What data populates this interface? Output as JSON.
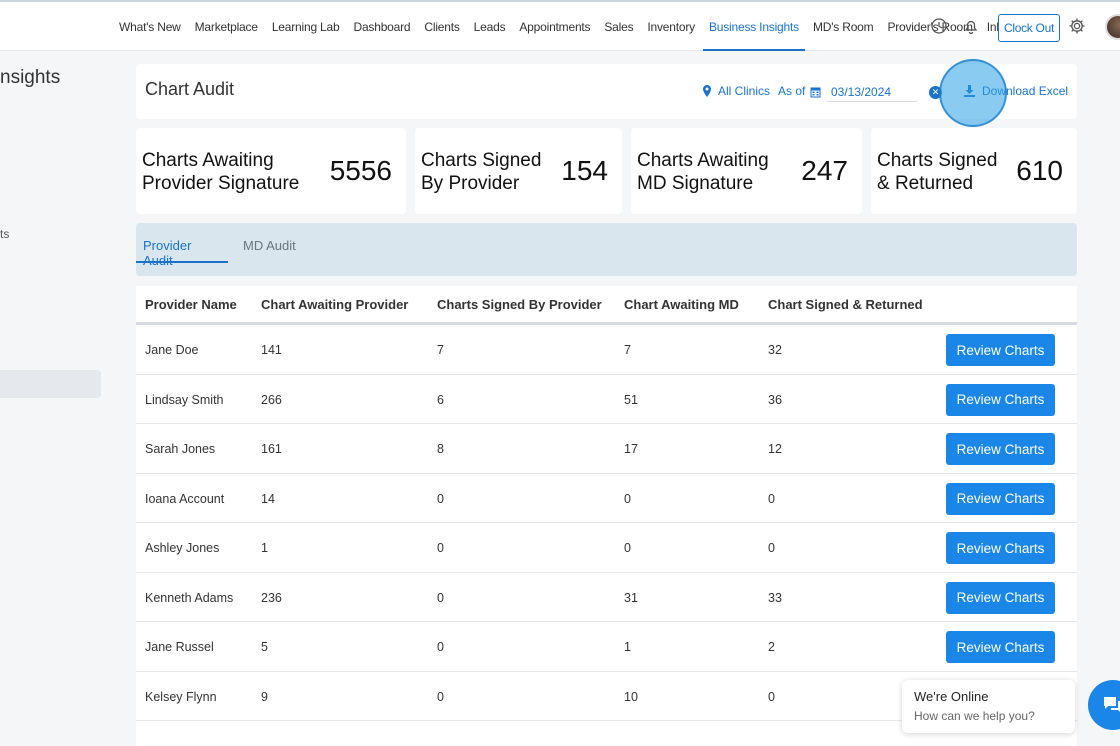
{
  "nav": {
    "items": [
      "What's New",
      "Marketplace",
      "Learning Lab",
      "Dashboard",
      "Clients",
      "Leads",
      "Appointments",
      "Sales",
      "Inventory",
      "Business Insights",
      "MD's Room",
      "Provider's Room",
      "Inbox"
    ],
    "active": "Business Insights",
    "clock_out_label": "Clock Out"
  },
  "sidebar": {
    "title": "nsights",
    "fragment": "ts"
  },
  "header": {
    "title": "Chart Audit",
    "clinic_filter": "All Clinics",
    "as_of_label": "As of",
    "date_value": "03/13/2024",
    "download_label": "Download Excel"
  },
  "stats": [
    {
      "label": "Charts Awaiting Provider Signature",
      "label_line1": "Charts Awaiting",
      "label_line2": "Provider Signature",
      "value": "5556"
    },
    {
      "label": "Charts Signed By Provider",
      "label_line1": "Charts Signed",
      "label_line2": "By Provider",
      "value": "154"
    },
    {
      "label": "Charts Awaiting MD Signature",
      "label_line1": "Charts Awaiting",
      "label_line2": "MD Signature",
      "value": "247"
    },
    {
      "label": "Charts Signed & Returned",
      "label_line1": "Charts Signed",
      "label_line2": "& Returned",
      "value": "610"
    }
  ],
  "tabs": [
    {
      "label": "Provider Audit",
      "active": true
    },
    {
      "label": "MD Audit",
      "active": false
    }
  ],
  "table": {
    "columns": [
      "Provider Name",
      "Chart Awaiting Provider",
      "Charts Signed By Provider",
      "Chart Awaiting MD",
      "Chart Signed & Returned"
    ],
    "action_label": "Review Charts",
    "rows": [
      {
        "name": "Jane Doe",
        "awaiting_provider": "141",
        "signed_by_provider": "7",
        "awaiting_md": "7",
        "signed_returned": "32"
      },
      {
        "name": "Lindsay Smith",
        "awaiting_provider": "266",
        "signed_by_provider": "6",
        "awaiting_md": "51",
        "signed_returned": "36"
      },
      {
        "name": "Sarah Jones",
        "awaiting_provider": "161",
        "signed_by_provider": "8",
        "awaiting_md": "17",
        "signed_returned": "12"
      },
      {
        "name": "Ioana Account",
        "awaiting_provider": "14",
        "signed_by_provider": "0",
        "awaiting_md": "0",
        "signed_returned": "0"
      },
      {
        "name": "Ashley Jones",
        "awaiting_provider": "1",
        "signed_by_provider": "0",
        "awaiting_md": "0",
        "signed_returned": "0"
      },
      {
        "name": "Kenneth Adams",
        "awaiting_provider": "236",
        "signed_by_provider": "0",
        "awaiting_md": "31",
        "signed_returned": "33"
      },
      {
        "name": "Jane Russel",
        "awaiting_provider": "5",
        "signed_by_provider": "0",
        "awaiting_md": "1",
        "signed_returned": "2"
      },
      {
        "name": "Kelsey Flynn",
        "awaiting_provider": "9",
        "signed_by_provider": "0",
        "awaiting_md": "10",
        "signed_returned": "0"
      }
    ]
  },
  "chat": {
    "title": "We're Online",
    "subtitle": "How can we help you?"
  },
  "icons": {
    "history": "history-icon",
    "bell": "bell-icon",
    "gear": "gear-icon",
    "pin": "location-pin-icon",
    "calendar": "calendar-icon",
    "download": "download-icon",
    "chat": "chat-icon"
  },
  "colors": {
    "accent": "#1a73c9",
    "button": "#1a87e8",
    "tab_bar": "#d9e6ed"
  }
}
